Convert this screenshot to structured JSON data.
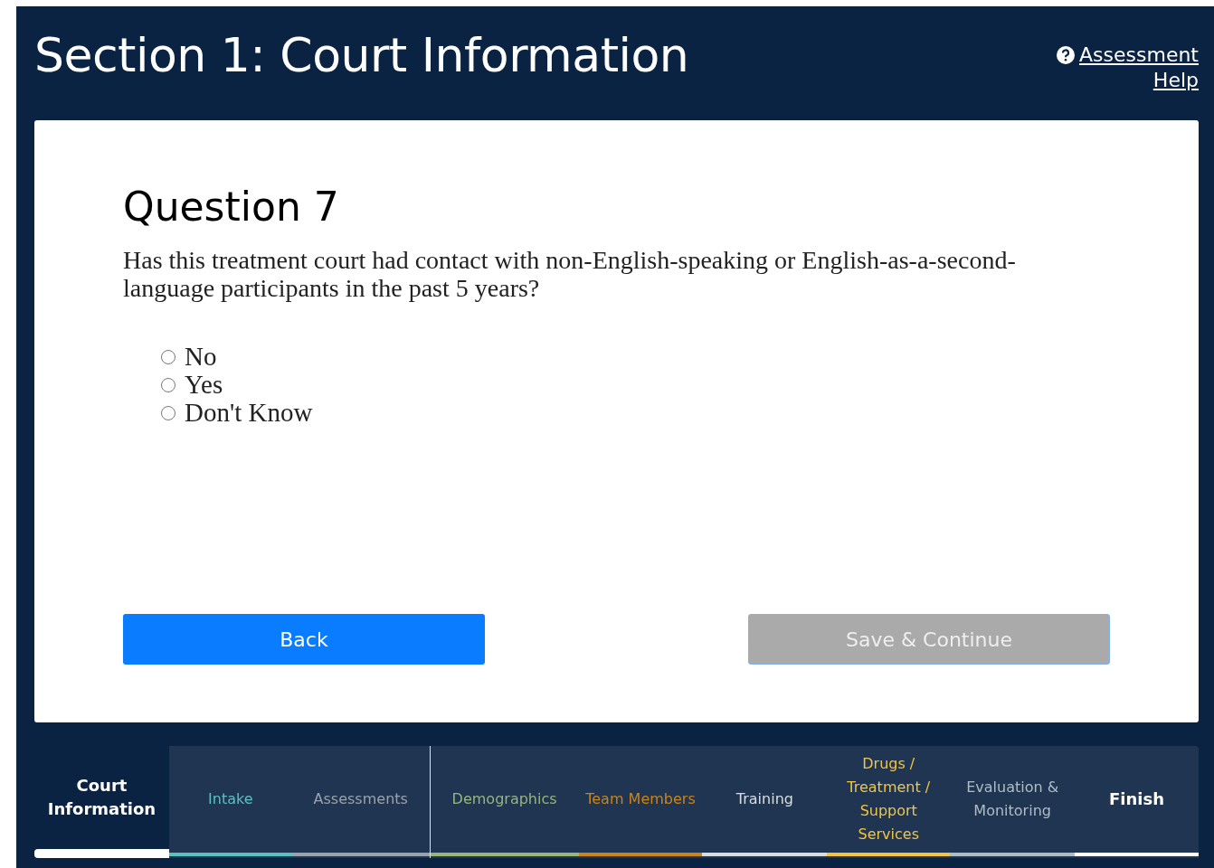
{
  "header": {
    "title": "Section 1: Court Information",
    "help_link": {
      "line_1": "Assessment",
      "line_2": "Help"
    }
  },
  "question": {
    "heading": "Question 7",
    "text": "Has this treatment court had contact with non-English-speaking or English-as-a-second-language participants in the past 5 years?",
    "options": [
      {
        "label": "No",
        "selected": false
      },
      {
        "label": "Yes",
        "selected": false
      },
      {
        "label": "Don't Know",
        "selected": false
      }
    ]
  },
  "buttons": [
    {
      "label": "Back",
      "disabled": false
    },
    {
      "label": "Save & Continue",
      "disabled": true
    }
  ],
  "tabs": [
    {
      "label": "Court Information",
      "selected": true,
      "bold": true,
      "color": "#ffffff",
      "divider_after": false
    },
    {
      "label": "Intake",
      "selected": false,
      "bold": false,
      "color": "#5bc0c0",
      "divider_after": false
    },
    {
      "label": "Assessments",
      "selected": false,
      "bold": false,
      "color": "#9aa3ad",
      "divider_after": true
    },
    {
      "label": "Demographics",
      "selected": false,
      "bold": false,
      "color": "#98b57c",
      "divider_after": false
    },
    {
      "label": "Team Members",
      "selected": false,
      "bold": false,
      "color": "#c9841a",
      "divider_after": false
    },
    {
      "label": "Training",
      "selected": false,
      "bold": false,
      "color": "#d8dde2",
      "divider_after": false
    },
    {
      "label": "Drugs / Treatment / Support Services",
      "selected": false,
      "bold": false,
      "color": "#f2c443",
      "divider_after": false
    },
    {
      "label": "Evaluation & Monitoring",
      "selected": false,
      "bold": false,
      "color": "#aebdc4",
      "divider_after": false
    },
    {
      "label": "Finish",
      "selected": false,
      "bold": true,
      "color": "#ffffff",
      "divider_after": false
    }
  ]
}
